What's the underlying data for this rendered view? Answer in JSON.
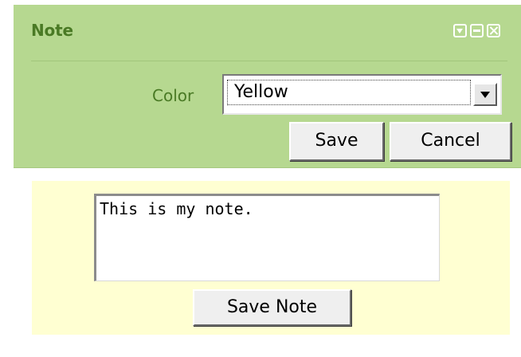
{
  "panel": {
    "title": "Note",
    "controls": [
      {
        "icon": "collapse-icon"
      },
      {
        "icon": "minimize-icon"
      },
      {
        "icon": "close-icon"
      }
    ],
    "color_label": "Color",
    "color_select": {
      "value": "Yellow",
      "icon": "chevron-down-icon"
    },
    "save_label": "Save",
    "cancel_label": "Cancel",
    "background_color": "#b6d890",
    "text_color": "#4a7a25"
  },
  "note": {
    "text": "This is my note.",
    "save_label": "Save Note",
    "background_color": "#ffffd2"
  }
}
